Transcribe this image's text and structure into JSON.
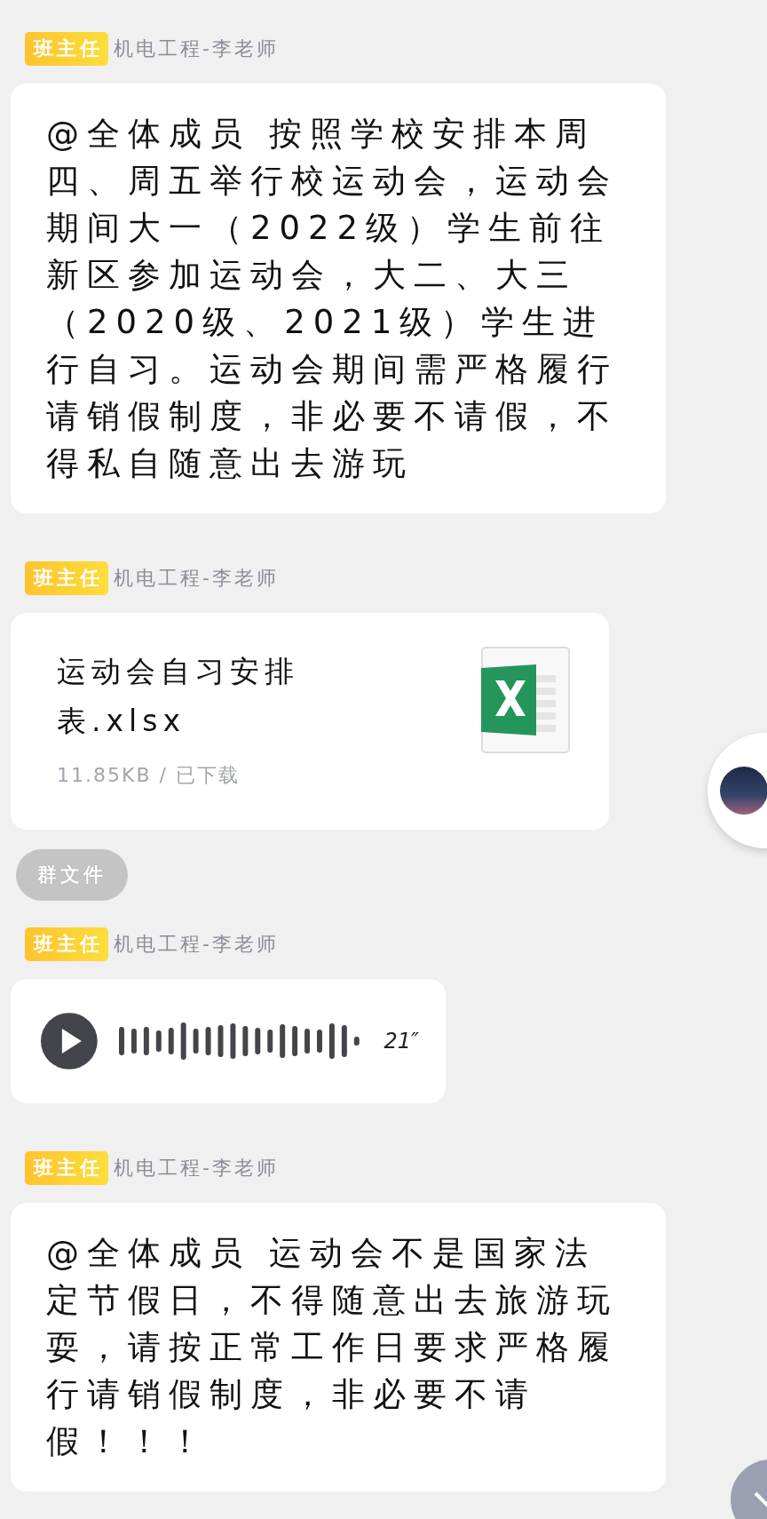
{
  "messages": [
    {
      "kind": "text",
      "role_badge": "班主任",
      "sender": "机电工程-李老师",
      "text": "@全体成员 按照学校安排本周四、周五举行校运动会，运动会期间大一（2022级）学生前往新区参加运动会，大二、大三（2020级、2021级）学生进行自习。运动会期间需严格履行请销假制度，非必要不请假，不得私自随意出去游玩"
    },
    {
      "kind": "file",
      "role_badge": "班主任",
      "sender": "机电工程-李老师",
      "file_name": "运动会自习安排表.xlsx",
      "file_meta": "11.85KB / 已下载",
      "tag": "群文件"
    },
    {
      "kind": "voice",
      "role_badge": "班主任",
      "sender": "机电工程-李老师",
      "duration": "21″"
    },
    {
      "kind": "text",
      "role_badge": "班主任",
      "sender": "机电工程-李老师",
      "text": "@全体成员 运动会不是国家法定节假日，不得随意出去旅游玩耍，请按正常工作日要求严格履行请销假制度，非必要不请假！！！"
    }
  ]
}
